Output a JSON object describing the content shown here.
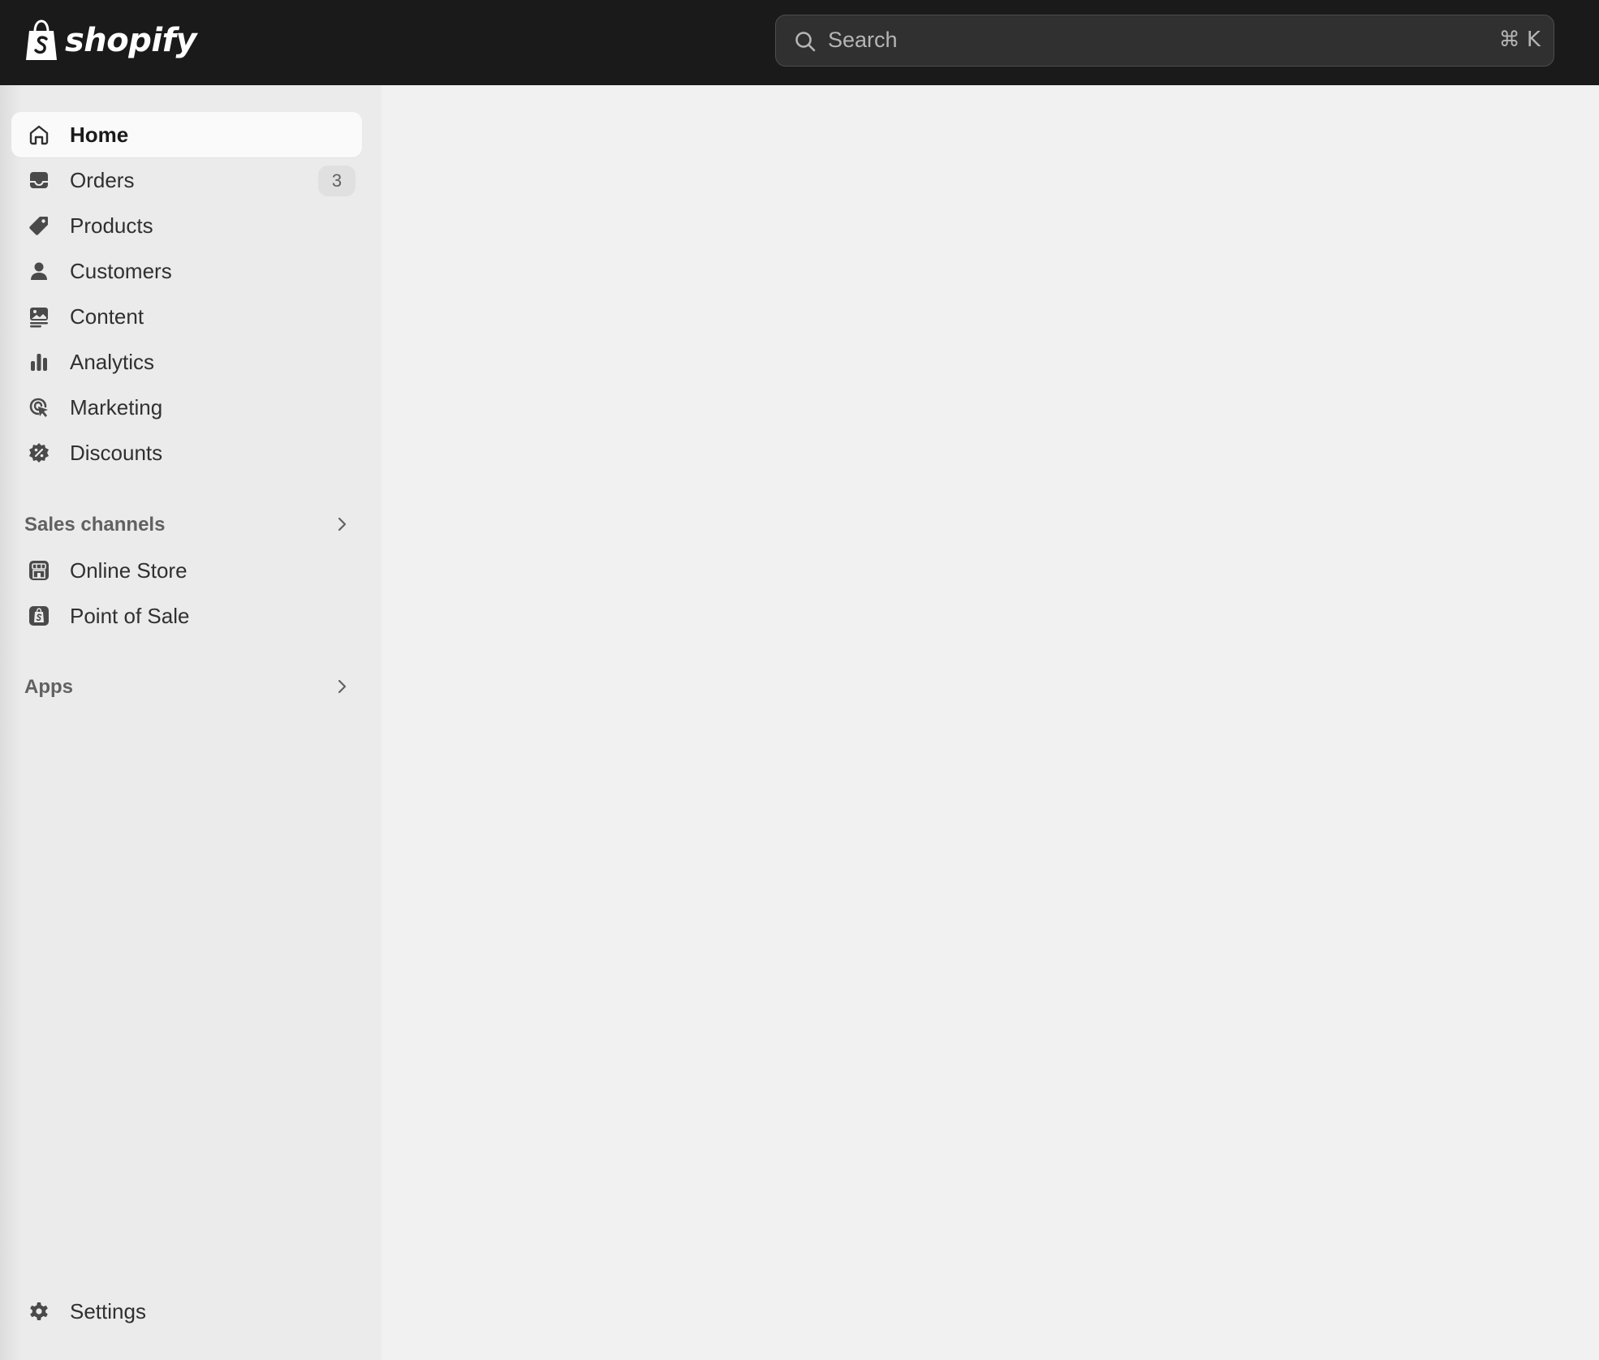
{
  "brand": {
    "name": "shopify"
  },
  "search": {
    "placeholder": "Search",
    "shortcut": "⌘ K"
  },
  "sidebar": {
    "items": [
      {
        "label": "Home",
        "icon": "home-icon",
        "active": true
      },
      {
        "label": "Orders",
        "icon": "inbox-icon",
        "badge": "3"
      },
      {
        "label": "Products",
        "icon": "tag-icon"
      },
      {
        "label": "Customers",
        "icon": "person-icon"
      },
      {
        "label": "Content",
        "icon": "content-icon"
      },
      {
        "label": "Analytics",
        "icon": "bar-chart-icon"
      },
      {
        "label": "Marketing",
        "icon": "target-icon"
      },
      {
        "label": "Discounts",
        "icon": "discount-icon"
      }
    ],
    "sales_channels": {
      "label": "Sales channels",
      "items": [
        {
          "label": "Online Store",
          "icon": "store-icon"
        },
        {
          "label": "Point of Sale",
          "icon": "pos-icon"
        }
      ]
    },
    "apps": {
      "label": "Apps"
    },
    "settings": {
      "label": "Settings",
      "icon": "gear-icon"
    }
  },
  "colors": {
    "topbar": "#1a1a1a",
    "sidebar": "#ebebeb",
    "main": "#f1f1f1",
    "active_item": "#fafafa",
    "text": "#303030"
  }
}
